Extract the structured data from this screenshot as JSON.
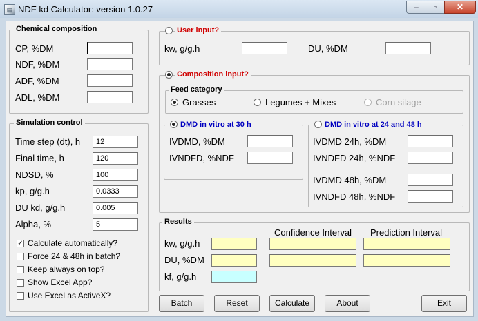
{
  "window": {
    "title": "NDF kd Calculator: version 1.0.27",
    "min_glyph": "–",
    "max_glyph": "▫",
    "close_glyph": "✕"
  },
  "chemical": {
    "legend": "Chemical composition",
    "fields": [
      {
        "label": "CP, %DM",
        "value": ""
      },
      {
        "label": "NDF, %DM",
        "value": ""
      },
      {
        "label": "ADF, %DM",
        "value": ""
      },
      {
        "label": "ADL, %DM",
        "value": ""
      }
    ]
  },
  "simulation": {
    "legend": "Simulation control",
    "fields": [
      {
        "label": "Time step (dt), h",
        "value": "12"
      },
      {
        "label": "Final time, h",
        "value": "120"
      },
      {
        "label": "NDSD, %",
        "value": "100"
      },
      {
        "label": "kp, g/g.h",
        "value": "0.0333"
      },
      {
        "label": "DU kd, g/g.h",
        "value": "0.005"
      },
      {
        "label": "Alpha, %",
        "value": "5"
      }
    ],
    "checks": [
      {
        "label": "Calculate automatically?",
        "checked": true
      },
      {
        "label": "Force 24 & 48h in batch?",
        "checked": false
      },
      {
        "label": "Keep always on top?",
        "checked": false
      },
      {
        "label": "Show Excel App?",
        "checked": false
      },
      {
        "label": "Use Excel as ActiveX?",
        "checked": false
      }
    ],
    "check_mark": "✓"
  },
  "user_input": {
    "legend": "User input?",
    "kw_label": "kw, g/g.h",
    "kw_value": "",
    "du_label": "DU, %DM",
    "du_value": ""
  },
  "composition": {
    "legend": "Composition input?",
    "feed": {
      "legend": "Feed category",
      "options": [
        {
          "label": "Grasses",
          "selected": true,
          "enabled": true
        },
        {
          "label": "Legumes + Mixes",
          "selected": false,
          "enabled": true
        },
        {
          "label": "Corn silage",
          "selected": false,
          "enabled": false
        }
      ]
    },
    "dmd30": {
      "legend": "DMD in vitro at 30 h",
      "fields": [
        {
          "label": "IVDMD, %DM",
          "value": ""
        },
        {
          "label": "IVNDFD, %NDF",
          "value": ""
        }
      ]
    },
    "dmd2448": {
      "legend": "DMD in vitro at 24 and 48 h",
      "fields": [
        {
          "label": "IVDMD 24h, %DM",
          "value": ""
        },
        {
          "label": "IVNDFD 24h, %NDF",
          "value": ""
        },
        {
          "label": "IVDMD 48h, %DM",
          "value": ""
        },
        {
          "label": "IVNDFD 48h, %NDF",
          "value": ""
        }
      ]
    }
  },
  "results": {
    "legend": "Results",
    "col_ci": "Confidence Interval",
    "col_pi": "Prediction Interval",
    "rows": [
      {
        "label": "kw, g/g.h",
        "value": "",
        "ci": "",
        "pi": ""
      },
      {
        "label": "DU, %DM",
        "value": "",
        "ci": "",
        "pi": ""
      },
      {
        "label": "kf, g/g.h",
        "value": ""
      }
    ]
  },
  "buttons": {
    "batch": "Batch",
    "reset": "Reset",
    "calculate": "Calculate",
    "about": "About",
    "exit": "Exit"
  },
  "colors": {
    "result_yellow": "#ffffc0",
    "result_cyan": "#c8ffff",
    "legend_red": "#d00000",
    "legend_blue": "#0000c0"
  }
}
